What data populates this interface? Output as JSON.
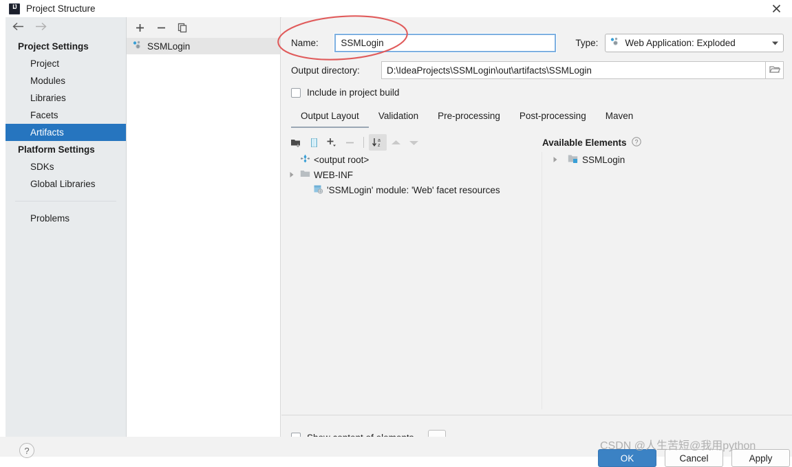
{
  "window": {
    "title": "Project Structure",
    "app_icon": "intellij-idea-icon",
    "close_icon": "close-icon"
  },
  "sidebar": {
    "back_icon": "arrow-left-icon",
    "forward_icon": "arrow-right-icon",
    "groups": [
      {
        "label": "Project Settings",
        "items": [
          {
            "label": "Project",
            "selected": false
          },
          {
            "label": "Modules",
            "selected": false
          },
          {
            "label": "Libraries",
            "selected": false
          },
          {
            "label": "Facets",
            "selected": false
          },
          {
            "label": "Artifacts",
            "selected": true
          }
        ]
      },
      {
        "label": "Platform Settings",
        "items": [
          {
            "label": "SDKs",
            "selected": false
          },
          {
            "label": "Global Libraries",
            "selected": false
          }
        ]
      }
    ],
    "extra": [
      {
        "label": "Problems",
        "selected": false
      }
    ]
  },
  "artifact_panel": {
    "toolbar": [
      {
        "name": "add-artifact-button",
        "glyph": "+"
      },
      {
        "name": "remove-artifact-button",
        "glyph": "−"
      },
      {
        "name": "copy-artifact-button",
        "glyph": "copy-icon"
      }
    ],
    "items": [
      {
        "label": "SSMLogin",
        "icon": "web-application-icon",
        "selected": true
      }
    ]
  },
  "detail": {
    "name_label": "Name:",
    "name_value": "SSMLogin",
    "type_label": "Type:",
    "type_value": "Web Application: Exploded",
    "type_icon": "web-application-icon",
    "type_dropdown_icon": "chevron-down-icon",
    "output_dir_label": "Output directory:",
    "output_dir_value": "D:\\IdeaProjects\\SSMLogin\\out\\artifacts\\SSMLogin",
    "browse_icon": "folder-open-icon",
    "include_in_build_label": "Include in project build",
    "include_in_build_checked": false,
    "tabs": [
      {
        "label": "Output Layout",
        "active": true
      },
      {
        "label": "Validation",
        "active": false
      },
      {
        "label": "Pre-processing",
        "active": false
      },
      {
        "label": "Post-processing",
        "active": false
      },
      {
        "label": "Maven",
        "active": false
      }
    ],
    "layout_toolbar": [
      {
        "name": "add-directory-button",
        "icon": "folder-add-icon",
        "state": "enabled"
      },
      {
        "name": "add-archive-button",
        "icon": "archive-icon",
        "state": "enabled"
      },
      {
        "name": "add-element-button",
        "icon": "plus-dropdown-icon",
        "state": "enabled"
      },
      {
        "name": "remove-element-button",
        "icon": "minus-icon",
        "state": "disabled"
      },
      {
        "name": "sort-button",
        "icon": "sort-az-icon",
        "state": "toggled"
      },
      {
        "name": "move-up-button",
        "icon": "arrow-up-icon",
        "state": "disabled"
      },
      {
        "name": "move-down-button",
        "icon": "arrow-down-icon",
        "state": "disabled"
      }
    ],
    "available_elements_label": "Available Elements",
    "available_help_icon": "help-circle-icon",
    "output_tree": [
      {
        "label": "<output root>",
        "icon": "output-root-icon",
        "indent": 0,
        "twisty": "none"
      },
      {
        "label": "WEB-INF",
        "icon": "folder-icon",
        "indent": 0,
        "twisty": "collapsed"
      },
      {
        "label": "'SSMLogin' module: 'Web' facet resources",
        "icon": "facet-resources-icon",
        "indent": 1,
        "twisty": "none"
      }
    ],
    "available_tree": [
      {
        "label": "SSMLogin",
        "icon": "module-icon",
        "indent": 0,
        "twisty": "collapsed"
      }
    ],
    "show_content_label": "Show content of elements",
    "show_content_checked": false,
    "ellipsis_label": "..."
  },
  "footer": {
    "help_label": "?",
    "ok_label": "OK",
    "cancel_label": "Cancel",
    "apply_label": "Apply"
  },
  "annotation": {
    "ellipse_color": "#e05b5b",
    "watermark": "CSDN @人生苦短@我用python"
  },
  "colors": {
    "accent": "#2675bf",
    "primary_button": "#3b82c4",
    "focus_border": "#7cafe0",
    "sidebar_bg": "#e8ebed",
    "panel_bg": "#f2f2f2"
  }
}
